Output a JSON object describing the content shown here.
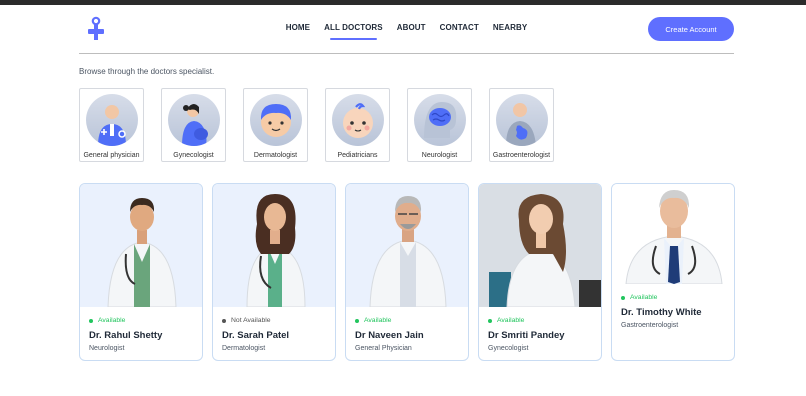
{
  "nav": {
    "items": [
      {
        "label": "HOME"
      },
      {
        "label": "ALL DOCTORS"
      },
      {
        "label": "ABOUT"
      },
      {
        "label": "CONTACT"
      },
      {
        "label": "NEARBY"
      }
    ],
    "active_index": 1,
    "create_account_label": "Create Account"
  },
  "colors": {
    "accent": "#5f6fff",
    "available": "#22c55e",
    "not_available": "#555555"
  },
  "browse_text": "Browse through the doctors specialist.",
  "specialties": [
    {
      "label": "General physician",
      "icon": "general-physician-icon"
    },
    {
      "label": "Gynecologist",
      "icon": "gynecologist-icon"
    },
    {
      "label": "Dermatologist",
      "icon": "dermatologist-icon"
    },
    {
      "label": "Pediatricians",
      "icon": "pediatrician-icon"
    },
    {
      "label": "Neurologist",
      "icon": "brain-icon"
    },
    {
      "label": "Gastroenterologist",
      "icon": "stomach-icon"
    }
  ],
  "doctors": [
    {
      "status": "Available",
      "name": "Dr. Rahul Shetty",
      "speciality": "Neurologist"
    },
    {
      "status": "Not Available",
      "name": "Dr. Sarah Patel",
      "speciality": "Dermatologist"
    },
    {
      "status": "Available",
      "name": "Dr Naveen Jain",
      "speciality": "General Physician"
    },
    {
      "status": "Available",
      "name": "Dr Smriti Pandey",
      "speciality": "Gynecologist"
    },
    {
      "status": "Available",
      "name": "Dr. Timothy White",
      "speciality": "Gastroenterologist"
    }
  ]
}
